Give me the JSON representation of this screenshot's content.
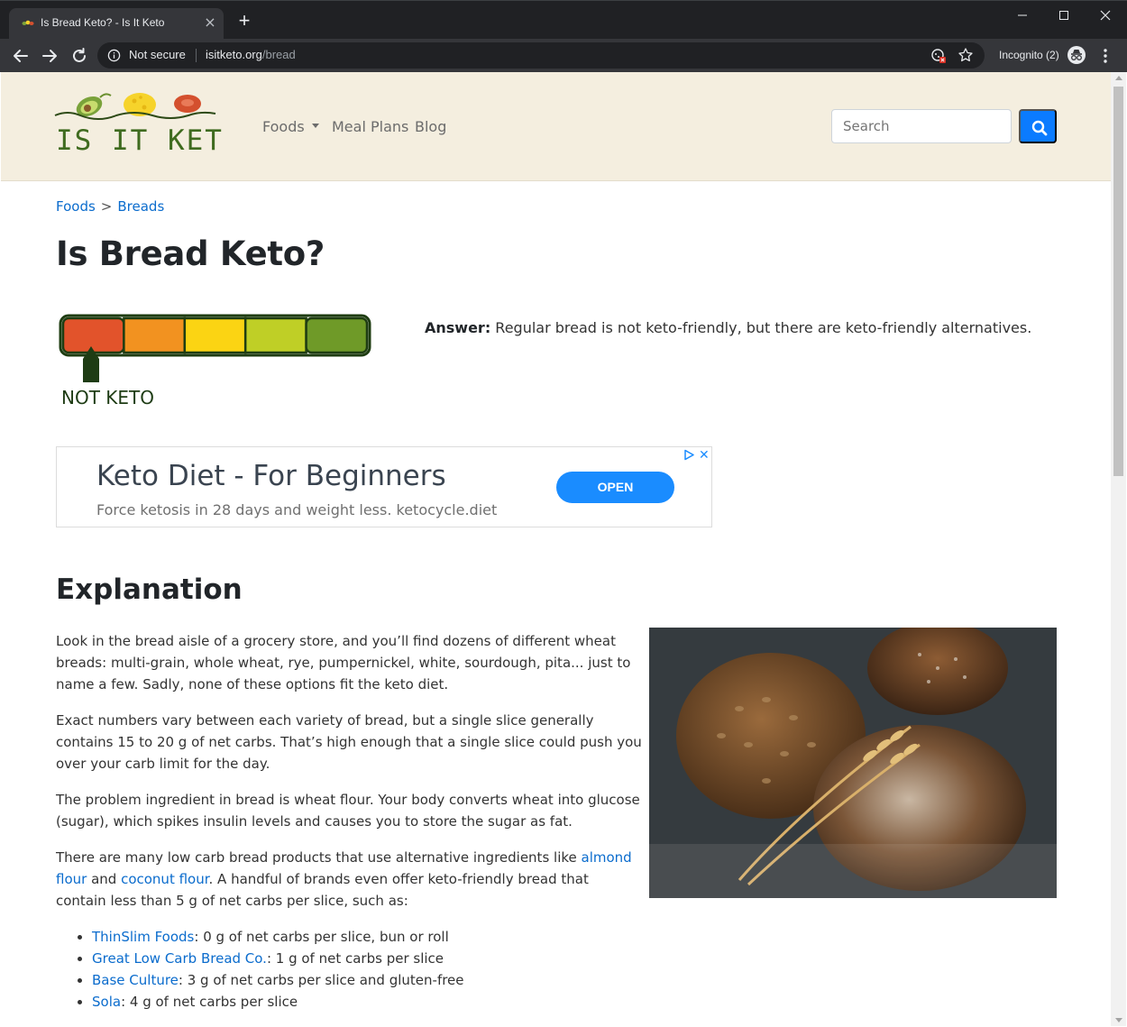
{
  "browser": {
    "tab_title": "Is Bread Keto? - Is It Keto",
    "new_tab": "+",
    "security_label": "Not secure",
    "url_host": "isitketo.org",
    "url_path": "/bread",
    "incognito_label": "Incognito (2)"
  },
  "site": {
    "logo_text": "IS IT KETO?",
    "nav": {
      "foods": "Foods",
      "meal_plans": "Meal Plans",
      "blog": "Blog"
    },
    "search_placeholder": "Search"
  },
  "breadcrumb": {
    "items": [
      "Foods",
      "Breads"
    ],
    "separator": ">"
  },
  "page": {
    "title": "Is Bread Keto?",
    "meter_label": "NOT KETO",
    "meter_level": 1,
    "meter_segments": 5,
    "meter_colors": [
      "#e2532b",
      "#f29220",
      "#fbd413",
      "#bfcf26",
      "#6f9a28"
    ],
    "answer_label": "Answer:",
    "answer_text": " Regular bread is not keto-friendly, but there are keto-friendly alternatives."
  },
  "ad": {
    "title": "Keto Diet - For Beginners",
    "subtitle": "Force ketosis in 28 days and weight less. ketocycle.diet",
    "button": "OPEN"
  },
  "explanation": {
    "heading": "Explanation",
    "p1": "Look in the bread aisle of a grocery store, and you’ll find dozens of different wheat breads: multi-grain, whole wheat, rye, pumpernickel, white, sourdough, pita... just to name a few. Sadly, none of these options fit the keto diet.",
    "p2": "Exact numbers vary between each variety of bread, but a single slice generally contains 15 to 20 g of net carbs. That’s high enough that a single slice could push you over your carb limit for the day.",
    "p3": "The problem ingredient in bread is wheat flour. Your body converts wheat into glucose (sugar), which spikes insulin levels and causes you to store the sugar as fat.",
    "p4_before": "There are many low carb bread products that use alternative ingredients like ",
    "p4_link1": "almond flour",
    "p4_mid": " and ",
    "p4_link2": "coconut flour",
    "p4_after": ". A handful of brands even offer keto-friendly bread that contain less than 5 g of net carbs per slice, such as:",
    "brands": [
      {
        "name": "ThinSlim Foods",
        "detail": ": 0 g of net carbs per slice, bun or roll"
      },
      {
        "name": "Great Low Carb Bread Co.",
        "detail": ": 1 g of net carbs per slice"
      },
      {
        "name": "Base Culture",
        "detail": ": 3 g of net carbs per slice and gluten-free"
      },
      {
        "name": "Sola",
        "detail": ": 4 g of net carbs per slice"
      }
    ]
  },
  "icons": {
    "back": "arrow-left-icon",
    "forward": "arrow-right-icon",
    "reload": "reload-icon",
    "info": "info-icon",
    "search": "search-icon",
    "star": "star-icon",
    "incognito": "incognito-icon",
    "menu": "kebab-menu-icon"
  }
}
